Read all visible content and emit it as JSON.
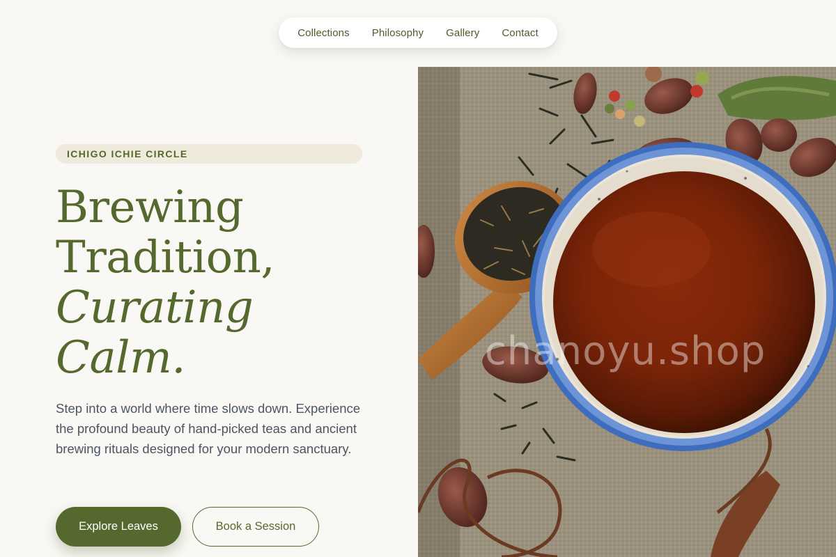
{
  "nav": {
    "items": [
      {
        "label": "Collections"
      },
      {
        "label": "Philosophy"
      },
      {
        "label": "Gallery"
      },
      {
        "label": "Contact"
      }
    ]
  },
  "hero": {
    "eyebrow": "ICHIGO ICHIE CIRCLE",
    "title_line1": "Brewing",
    "title_line2": "Tradition,",
    "title_line3": "Curating",
    "title_line4": "Calm.",
    "intro": "Step into a world where time slows down. Experience the profound beauty of hand-picked teas and ancient brewing rituals designed for your modern sanctuary.",
    "primary_cta": "Explore Leaves",
    "secondary_cta": "Book a Session"
  },
  "image": {
    "watermark": "chanoyu.shop"
  },
  "colors": {
    "accent": "#55692e",
    "background": "#f9f8f4",
    "eyebrow_bg": "#efeadb",
    "body_text": "#4b5563"
  }
}
